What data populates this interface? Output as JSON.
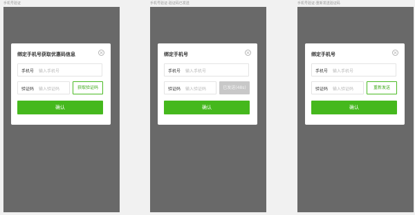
{
  "screens": [
    {
      "label": "手机号验证",
      "title": "绑定手机号获取优惠码信息",
      "phone_label": "手机号",
      "phone_placeholder": "输入手机号",
      "code_label": "验证码",
      "code_placeholder": "输入验证码",
      "code_button": "获取验证码",
      "code_button_state": "active",
      "confirm": "确认"
    },
    {
      "label": "手机号验证-验证码已发送",
      "title": "绑定手机号",
      "phone_label": "手机号",
      "phone_placeholder": "输入手机号",
      "code_label": "验证码",
      "code_placeholder": "输入验证码",
      "code_button": "已发送(48s)",
      "code_button_state": "disabled",
      "confirm": "确认"
    },
    {
      "label": "手机号验证-重新发送验证码",
      "title": "绑定手机号",
      "phone_label": "手机号",
      "phone_placeholder": "输入手机号",
      "code_label": "验证码",
      "code_placeholder": "输入验证码",
      "code_button": "重新发送",
      "code_button_state": "active",
      "confirm": "确认"
    }
  ],
  "colors": {
    "accent": "#45b81d",
    "overlay": "#696969",
    "disabled": "#c8c8c8"
  },
  "icons": {
    "close": "close-icon"
  }
}
